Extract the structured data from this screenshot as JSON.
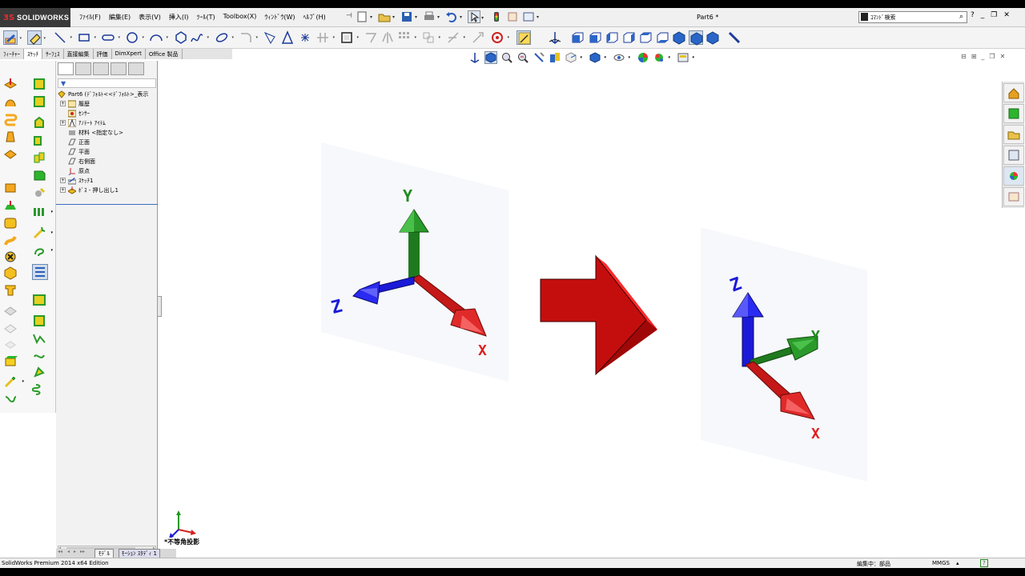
{
  "app": {
    "brand": "SOLIDWORKS",
    "brand_mark": "3S",
    "document_title": "Part6 *",
    "search_placeholder": "ｺﾏﾝﾄﾞ検索"
  },
  "menu": [
    "ﾌｧｲﾙ(F)",
    "編集(E)",
    "表示(V)",
    "挿入(I)",
    "ﾂｰﾙ(T)",
    "Toolbox(X)",
    "ｳｨﾝﾄﾞｳ(W)",
    "ﾍﾙﾌﾟ(H)"
  ],
  "command_tabs": [
    "ﾌｨｰﾁｬｰ",
    "ｽｹｯﾁ",
    "ｻｰﾌｪｽ",
    "直接編集",
    "評価",
    "DimXpert",
    "Office 製品"
  ],
  "active_command_tab": "ｽｹｯﾁ",
  "feature_tree": {
    "root": "Part6  (ﾃﾞﾌｫﾙﾄ<<ﾃﾞﾌｫﾙﾄ>_表示",
    "items": [
      {
        "label": "履歴",
        "icon": "history-folder-icon",
        "expandable": true
      },
      {
        "label": "ｾﾝｻｰ",
        "icon": "sensor-icon",
        "expandable": false
      },
      {
        "label": "ｱﾉﾃｰﾄ ｱｲﾃﾑ",
        "icon": "annotation-icon",
        "expandable": true
      },
      {
        "label": "材料 <指定なし>",
        "icon": "material-icon",
        "expandable": false
      },
      {
        "label": "正面",
        "icon": "plane-icon",
        "expandable": false
      },
      {
        "label": "平面",
        "icon": "plane-icon",
        "expandable": false
      },
      {
        "label": "右側面",
        "icon": "plane-icon",
        "expandable": false
      },
      {
        "label": "原点",
        "icon": "origin-icon",
        "expandable": false
      },
      {
        "label": "ｽｹｯﾁ1",
        "icon": "sketch-icon",
        "expandable": true
      },
      {
        "label": "ﾎﾞｽ - 押し出し1",
        "icon": "extrude-icon",
        "expandable": true
      }
    ]
  },
  "bottom_tabs": {
    "model": "ﾓﾃﾞﾙ",
    "motion": "ﾓｰｼｮﾝ ｽﾀﾃﾞｨ 1"
  },
  "view_label": "*不等角投影",
  "status": {
    "left": "SolidWorks Premium 2014 x64 Edition",
    "mode": "編集中：部品",
    "units": "MMGS",
    "help": "?"
  },
  "colors": {
    "x_axis": "#d62020",
    "y_axis": "#1f7a1f",
    "z_axis": "#1a1ad8",
    "arrow": "#cc1010",
    "accent": "#3a6ec0"
  },
  "diagram": {
    "before": {
      "x": "X",
      "y": "Y",
      "z": "Z"
    },
    "after": {
      "x": "X",
      "y": "Y",
      "z": "Z"
    },
    "transition": "arrow-right"
  }
}
